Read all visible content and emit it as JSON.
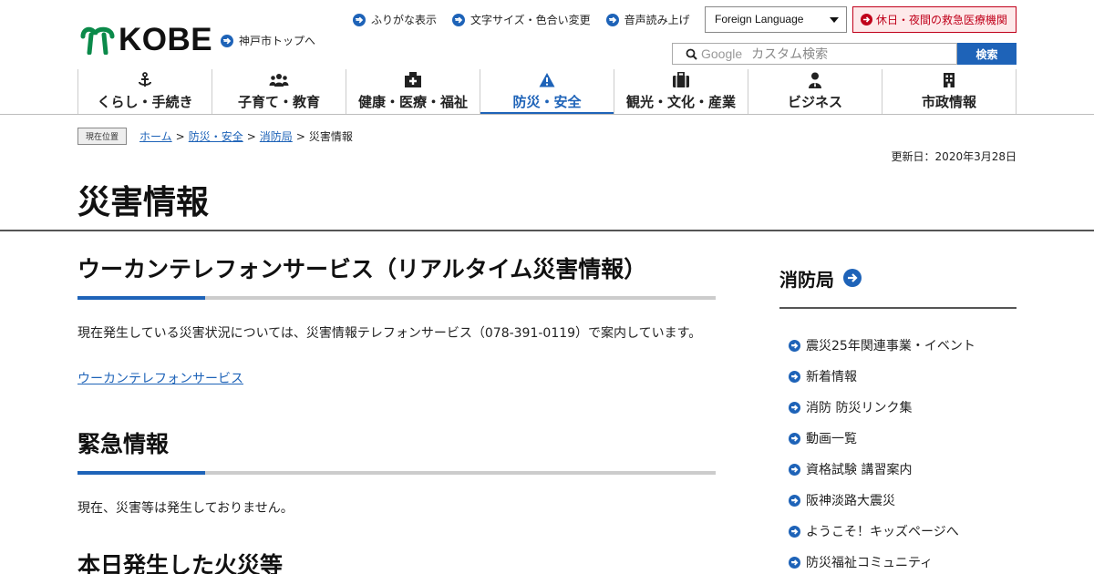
{
  "header": {
    "logo_text": "KOBE",
    "top_link": "神戸市トップへ",
    "utility_links": [
      "ふりがな表示",
      "文字サイズ・色合い変更",
      "音声読み上げ"
    ],
    "language_select": "Foreign Language",
    "emergency_link": "休日・夜間の救急医療機関",
    "search": {
      "placeholder_brand": "Google",
      "placeholder": "カスタム検索",
      "button": "検索"
    }
  },
  "nav": {
    "items": [
      {
        "label": "くらし・手続き",
        "icon": "anchor-icon"
      },
      {
        "label": "子育て・教育",
        "icon": "people-icon"
      },
      {
        "label": "健康・医療・福祉",
        "icon": "hospital-icon"
      },
      {
        "label": "防災・安全",
        "icon": "warning-icon",
        "active": true
      },
      {
        "label": "観光・文化・産業",
        "icon": "suitcase-icon"
      },
      {
        "label": "ビジネス",
        "icon": "person-icon"
      },
      {
        "label": "市政情報",
        "icon": "building-icon"
      }
    ]
  },
  "breadcrumb": {
    "here_label": "現在位置",
    "items": [
      "ホーム",
      "防災・安全",
      "消防局"
    ],
    "current": "災害情報",
    "separator": ">"
  },
  "updated": "更新日：2020年3月28日",
  "page_title": "災害情報",
  "sections": [
    {
      "heading": "ウーカンテレフォンサービス（リアルタイム災害情報）",
      "text": "現在発生している災害状況については、災害情報テレフォンサービス（078-391-0119）で案内しています。",
      "link": "ウーカンテレフォンサービス"
    },
    {
      "heading": "緊急情報",
      "text": "現在、災害等は発生しておりません。"
    },
    {
      "heading": "本日発生した火災等"
    }
  ],
  "side": {
    "heading": "消防局",
    "items": [
      "震災25年関連事業・イベント",
      "新着情報",
      "消防 防災リンク集",
      "動画一覧",
      "資格試験 講習案内",
      "阪神淡路大震災",
      "ようこそ！キッズページへ",
      "防災福祉コミュニティ"
    ]
  },
  "colors": {
    "accent": "#1e63b8",
    "logo_green": "#0b8a4a",
    "emergency": "#c0001a"
  }
}
